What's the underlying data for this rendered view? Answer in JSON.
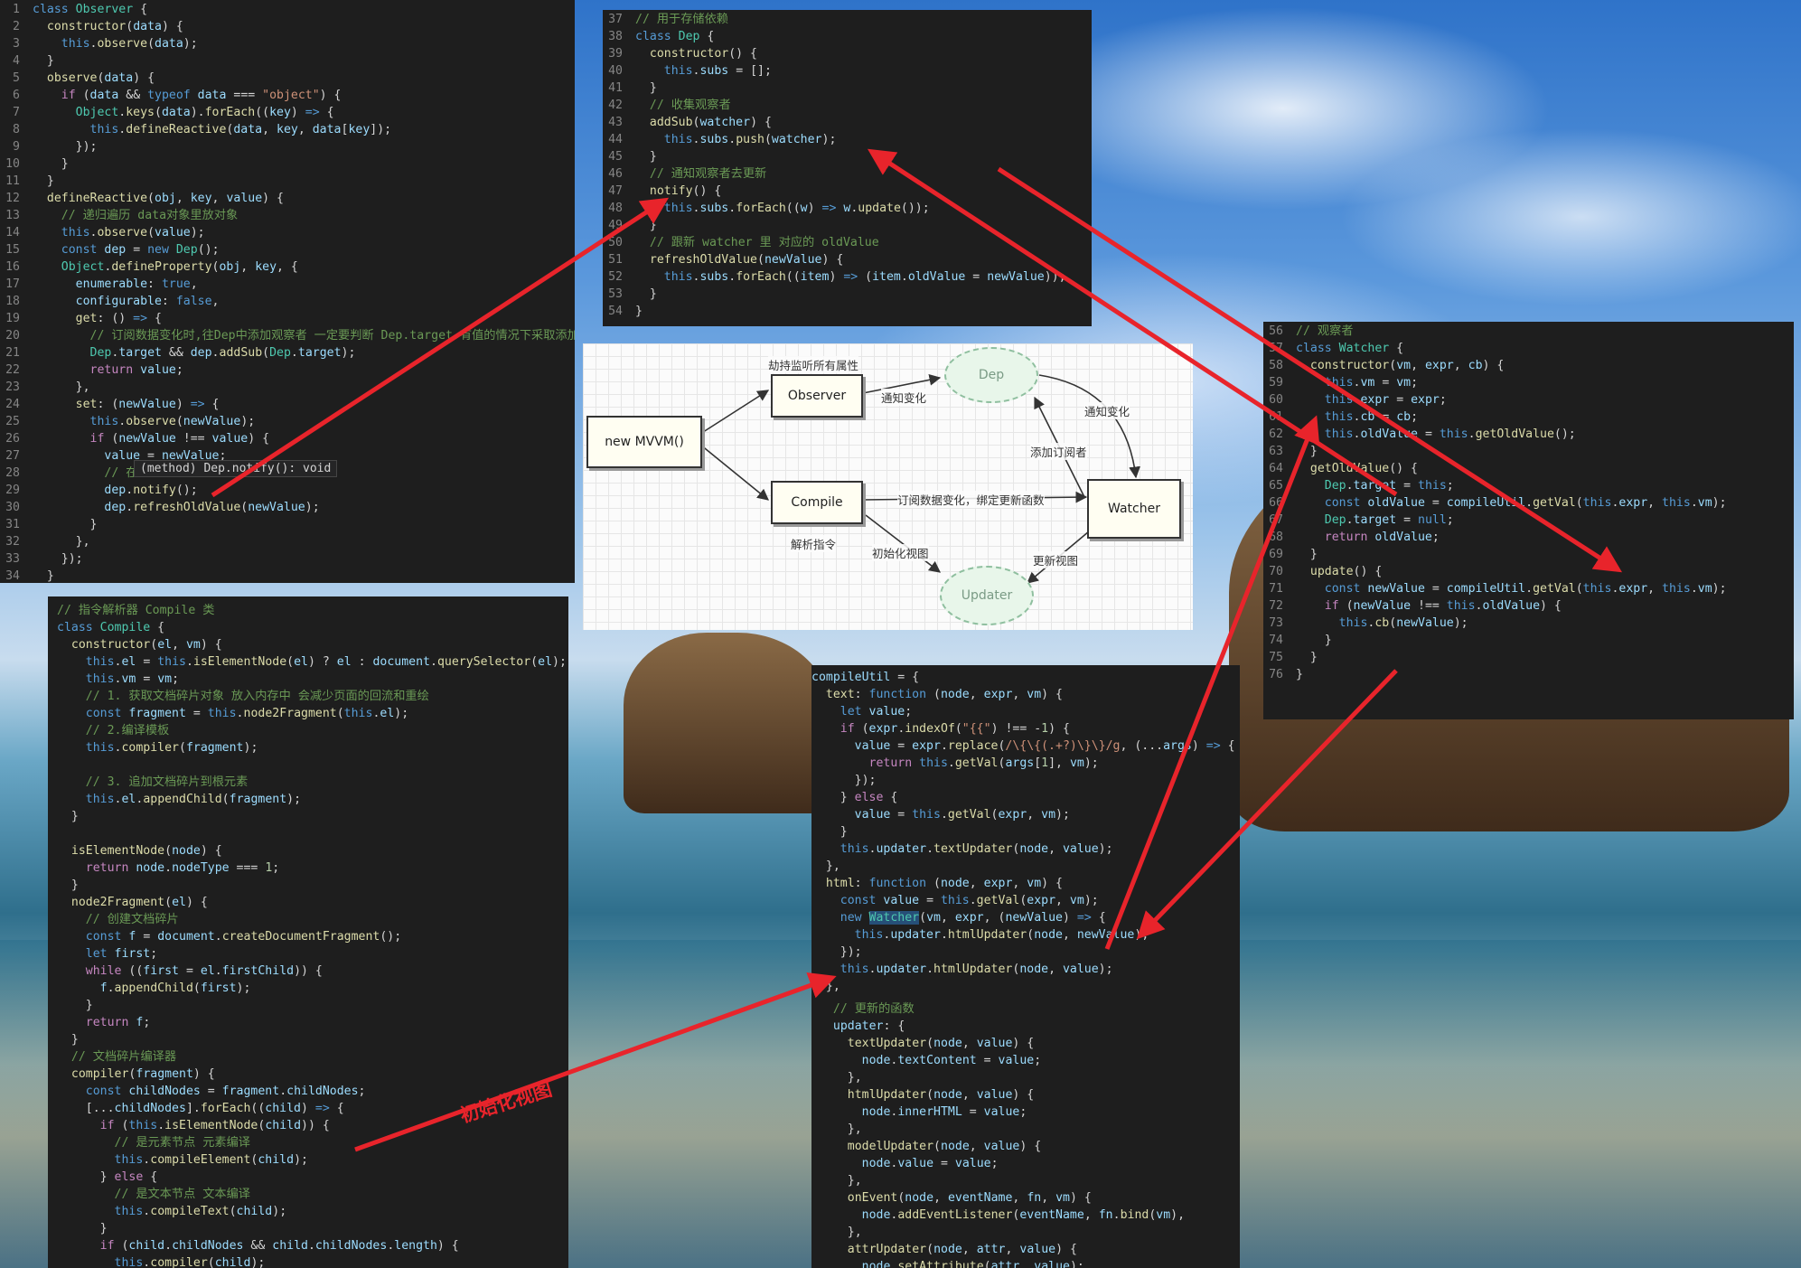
{
  "panel_observer": {
    "lines": [
      {
        "n": "1",
        "h": "<span class='k'>class</span> <span class='t'>Observer</span> {"
      },
      {
        "n": "2",
        "h": "  <span class='f'>constructor</span>(<span class='v'>data</span>) {"
      },
      {
        "n": "3",
        "h": "    <span class='k'>this</span>.<span class='f'>observe</span>(<span class='v'>data</span>);"
      },
      {
        "n": "4",
        "h": "  }"
      },
      {
        "n": "5",
        "h": "  <span class='f'>observe</span>(<span class='v'>data</span>) {"
      },
      {
        "n": "6",
        "h": "    <span class='p'>if</span> (<span class='v'>data</span> &amp;&amp; <span class='k'>typeof</span> <span class='v'>data</span> === <span class='s'>\"object\"</span>) {"
      },
      {
        "n": "7",
        "h": "      <span class='t'>Object</span>.<span class='f'>keys</span>(<span class='v'>data</span>).<span class='f'>forEach</span>((<span class='v'>key</span>) <span class='k'>=&gt;</span> {"
      },
      {
        "n": "8",
        "h": "        <span class='k'>this</span>.<span class='f'>defineReactive</span>(<span class='v'>data</span>, <span class='v'>key</span>, <span class='v'>data</span>[<span class='v'>key</span>]);"
      },
      {
        "n": "9",
        "h": "      });"
      },
      {
        "n": "10",
        "h": "    }"
      },
      {
        "n": "11",
        "h": "  }"
      },
      {
        "n": "12",
        "h": "  <span class='f'>defineReactive</span>(<span class='v'>obj</span>, <span class='v'>key</span>, <span class='v'>value</span>) {"
      },
      {
        "n": "13",
        "h": "    <span class='c'>// 递归遍历 data对象里放对象</span>"
      },
      {
        "n": "14",
        "h": "    <span class='k'>this</span>.<span class='f'>observe</span>(<span class='v'>value</span>);"
      },
      {
        "n": "15",
        "h": "    <span class='k'>const</span> <span class='v'>dep</span> = <span class='k'>new</span> <span class='t'>Dep</span>();"
      },
      {
        "n": "16",
        "h": "    <span class='t'>Object</span>.<span class='f'>defineProperty</span>(<span class='v'>obj</span>, <span class='v'>key</span>, {"
      },
      {
        "n": "17",
        "h": "      <span class='v'>enumerable</span>: <span class='k'>true</span>,"
      },
      {
        "n": "18",
        "h": "      <span class='v'>configurable</span>: <span class='k'>false</span>,"
      },
      {
        "n": "19",
        "h": "      <span class='f'>get</span>: () <span class='k'>=&gt;</span> {"
      },
      {
        "n": "20",
        "h": "        <span class='c'>// 订阅数据变化时,往Dep中添加观察者 一定要判断 Dep.target 有值的情况下采取添加</span>"
      },
      {
        "n": "21",
        "h": "        <span class='t'>Dep</span>.<span class='v'>target</span> &amp;&amp; <span class='v'>dep</span>.<span class='f'>addSub</span>(<span class='t'>Dep</span>.<span class='v'>target</span>);"
      },
      {
        "n": "22",
        "h": "        <span class='p'>return</span> <span class='v'>value</span>;"
      },
      {
        "n": "23",
        "h": "      },"
      },
      {
        "n": "24",
        "h": "      <span class='f'>set</span>: (<span class='v'>newValue</span>) <span class='k'>=&gt;</span> {"
      },
      {
        "n": "25",
        "h": "        <span class='k'>this</span>.<span class='f'>observe</span>(<span class='v'>newValue</span>);"
      },
      {
        "n": "26",
        "h": "        <span class='p'>if</span> (<span class='v'>newValue</span> !== <span class='v'>value</span>) {"
      },
      {
        "n": "27",
        "h": "          <span class='v'>value</span> = <span class='v'>newValue</span>;"
      },
      {
        "n": "28",
        "h": "          <span class='c'>// 在</span>"
      },
      {
        "n": "29",
        "h": "          <span class='v'>dep</span>.<span class='f'>notify</span>();"
      },
      {
        "n": "30",
        "h": "          <span class='v'>dep</span>.<span class='f'>refreshOldValue</span>(<span class='v'>newValue</span>);"
      },
      {
        "n": "31",
        "h": "        }"
      },
      {
        "n": "32",
        "h": "      },"
      },
      {
        "n": "33",
        "h": "    });"
      },
      {
        "n": "34",
        "h": "  }"
      }
    ],
    "tooltip": "(method) Dep.notify(): void"
  },
  "panel_dep": {
    "lines": [
      {
        "n": "37",
        "h": "<span class='c'>// 用于存储依赖</span>"
      },
      {
        "n": "38",
        "h": "<span class='k'>class</span> <span class='t'>Dep</span> {"
      },
      {
        "n": "39",
        "h": "  <span class='f'>constructor</span>() {"
      },
      {
        "n": "40",
        "h": "    <span class='k'>this</span>.<span class='v'>subs</span> = [];"
      },
      {
        "n": "41",
        "h": "  }"
      },
      {
        "n": "42",
        "h": "  <span class='c'>// 收集观察者</span>"
      },
      {
        "n": "43",
        "h": "  <span class='f'>addSub</span>(<span class='v'>watcher</span>) {"
      },
      {
        "n": "44",
        "h": "    <span class='k'>this</span>.<span class='v'>subs</span>.<span class='f'>push</span>(<span class='v'>watcher</span>);"
      },
      {
        "n": "45",
        "h": "  }"
      },
      {
        "n": "46",
        "h": "  <span class='c'>// 通知观察者去更新</span>"
      },
      {
        "n": "47",
        "h": "  <span class='f'>notify</span>() {"
      },
      {
        "n": "48",
        "h": "    <span class='k'>this</span>.<span class='v'>subs</span>.<span class='f'>forEach</span>((<span class='v'>w</span>) <span class='k'>=&gt;</span> <span class='v'>w</span>.<span class='f'>update</span>());"
      },
      {
        "n": "49",
        "h": "  }"
      },
      {
        "n": "50",
        "h": "  <span class='c'>// 跟新 watcher 里 对应的 oldValue</span>"
      },
      {
        "n": "51",
        "h": "  <span class='f'>refreshOldValue</span>(<span class='v'>newValue</span>) {"
      },
      {
        "n": "52",
        "h": "    <span class='k'>this</span>.<span class='v'>subs</span>.<span class='f'>forEach</span>((<span class='v'>item</span>) <span class='k'>=&gt;</span> (<span class='v'>item</span>.<span class='v'>oldValue</span> = <span class='v'>newValue</span>));"
      },
      {
        "n": "53",
        "h": "  }"
      },
      {
        "n": "54",
        "h": "}"
      }
    ]
  },
  "panel_watcher": {
    "lines": [
      {
        "n": "56",
        "h": "<span class='c'>// 观察者</span>"
      },
      {
        "n": "57",
        "h": "<span class='k'>class</span> <span class='t'>Watcher</span> {"
      },
      {
        "n": "58",
        "h": "  <span class='f'>constructor</span>(<span class='v'>vm</span>, <span class='v'>expr</span>, <span class='v'>cb</span>) {"
      },
      {
        "n": "59",
        "h": "    <span class='k'>this</span>.<span class='v'>vm</span> = <span class='v'>vm</span>;"
      },
      {
        "n": "60",
        "h": "    <span class='k'>this</span>.<span class='v'>expr</span> = <span class='v'>expr</span>;"
      },
      {
        "n": "61",
        "h": "    <span class='k'>this</span>.<span class='v'>cb</span> = <span class='v'>cb</span>;"
      },
      {
        "n": "62",
        "h": "    <span class='k'>this</span>.<span class='v'>oldValue</span> = <span class='k'>this</span>.<span class='f'>getOldValue</span>();"
      },
      {
        "n": "63",
        "h": "  }"
      },
      {
        "n": "64",
        "h": "  <span class='f'>getOldValue</span>() {"
      },
      {
        "n": "65",
        "h": "    <span class='t'>Dep</span>.<span class='v'>target</span> = <span class='k'>this</span>;"
      },
      {
        "n": "66",
        "h": "    <span class='k'>const</span> <span class='v'>oldValue</span> = <span class='v'>compileUtil</span>.<span class='f'>getVal</span>(<span class='k'>this</span>.<span class='v'>expr</span>, <span class='k'>this</span>.<span class='v'>vm</span>);"
      },
      {
        "n": "67",
        "h": "    <span class='t'>Dep</span>.<span class='v'>target</span> = <span class='k'>null</span>;"
      },
      {
        "n": "68",
        "h": "    <span class='p'>return</span> <span class='v'>oldValue</span>;"
      },
      {
        "n": "69",
        "h": "  }"
      },
      {
        "n": "70",
        "h": "  <span class='f'>update</span>() {"
      },
      {
        "n": "71",
        "h": "    <span class='k'>const</span> <span class='v'>newValue</span> = <span class='v'>compileUtil</span>.<span class='f'>getVal</span>(<span class='k'>this</span>.<span class='v'>expr</span>, <span class='k'>this</span>.<span class='v'>vm</span>);"
      },
      {
        "n": "72",
        "h": "    <span class='p'>if</span> (<span class='v'>newValue</span> !== <span class='k'>this</span>.<span class='v'>oldValue</span>) {"
      },
      {
        "n": "73",
        "h": "      <span class='k'>this</span>.<span class='f'>cb</span>(<span class='v'>newValue</span>);"
      },
      {
        "n": "74",
        "h": "    }"
      },
      {
        "n": "75",
        "h": "  }"
      },
      {
        "n": "76",
        "h": "}"
      }
    ]
  },
  "panel_compile": {
    "lines": [
      {
        "n": "",
        "h": "<span class='c'>// 指令解析器 Compile 类</span>"
      },
      {
        "n": "",
        "h": "<span class='k'>class</span> <span class='t'>Compile</span> {"
      },
      {
        "n": "",
        "h": "  <span class='f'>constructor</span>(<span class='v'>el</span>, <span class='v'>vm</span>) {"
      },
      {
        "n": "",
        "h": "    <span class='k'>this</span>.<span class='v'>el</span> = <span class='k'>this</span>.<span class='f'>isElementNode</span>(<span class='v'>el</span>) ? <span class='v'>el</span> : <span class='v'>document</span>.<span class='f'>querySelector</span>(<span class='v'>el</span>);"
      },
      {
        "n": "",
        "h": "    <span class='k'>this</span>.<span class='v'>vm</span> = <span class='v'>vm</span>;"
      },
      {
        "n": "",
        "h": "    <span class='c'>// 1. 获取文档碎片对象 放入内存中 会减少页面的回流和重绘</span>"
      },
      {
        "n": "",
        "h": "    <span class='k'>const</span> <span class='v'>fragment</span> = <span class='k'>this</span>.<span class='f'>node2Fragment</span>(<span class='k'>this</span>.<span class='v'>el</span>);"
      },
      {
        "n": "",
        "h": "    <span class='c'>// 2.编译模板</span>"
      },
      {
        "n": "",
        "h": "    <span class='k'>this</span>.<span class='f'>compiler</span>(<span class='v'>fragment</span>);"
      },
      {
        "n": "",
        "h": ""
      },
      {
        "n": "",
        "h": "    <span class='c'>// 3. 追加文档碎片到根元素</span>"
      },
      {
        "n": "",
        "h": "    <span class='k'>this</span>.<span class='v'>el</span>.<span class='f'>appendChild</span>(<span class='v'>fragment</span>);"
      },
      {
        "n": "",
        "h": "  }"
      },
      {
        "n": "",
        "h": ""
      },
      {
        "n": "",
        "h": "  <span class='f'>isElementNode</span>(<span class='v'>node</span>) {"
      },
      {
        "n": "",
        "h": "    <span class='p'>return</span> <span class='v'>node</span>.<span class='v'>nodeType</span> === <span class='n'>1</span>;"
      },
      {
        "n": "",
        "h": "  }"
      },
      {
        "n": "",
        "h": "  <span class='f'>node2Fragment</span>(<span class='v'>el</span>) {"
      },
      {
        "n": "",
        "h": "    <span class='c'>// 创建文档碎片</span>"
      },
      {
        "n": "",
        "h": "    <span class='k'>const</span> <span class='v'>f</span> = <span class='v'>document</span>.<span class='f'>createDocumentFragment</span>();"
      },
      {
        "n": "",
        "h": "    <span class='k'>let</span> <span class='v'>first</span>;"
      },
      {
        "n": "",
        "h": "    <span class='p'>while</span> ((<span class='v'>first</span> = <span class='v'>el</span>.<span class='v'>firstChild</span>)) {"
      },
      {
        "n": "",
        "h": "      <span class='v'>f</span>.<span class='f'>appendChild</span>(<span class='v'>first</span>);"
      },
      {
        "n": "",
        "h": "    }"
      },
      {
        "n": "",
        "h": "    <span class='p'>return</span> <span class='v'>f</span>;"
      },
      {
        "n": "",
        "h": "  }"
      },
      {
        "n": "",
        "h": "  <span class='c'>// 文档碎片编译器</span>"
      },
      {
        "n": "",
        "h": "  <span class='f'>compiler</span>(<span class='v'>fragment</span>) {"
      },
      {
        "n": "",
        "h": "    <span class='k'>const</span> <span class='v'>childNodes</span> = <span class='v'>fragment</span>.<span class='v'>childNodes</span>;"
      },
      {
        "n": "",
        "h": "    [...<span class='v'>childNodes</span>].<span class='f'>forEach</span>((<span class='v'>child</span>) <span class='k'>=&gt;</span> {"
      },
      {
        "n": "",
        "h": "      <span class='p'>if</span> (<span class='k'>this</span>.<span class='f'>isElementNode</span>(<span class='v'>child</span>)) {"
      },
      {
        "n": "",
        "h": "        <span class='c'>// 是元素节点 元素编译</span>"
      },
      {
        "n": "",
        "h": "        <span class='k'>this</span>.<span class='f'>compileElement</span>(<span class='v'>child</span>);"
      },
      {
        "n": "",
        "h": "      } <span class='p'>else</span> {"
      },
      {
        "n": "",
        "h": "        <span class='c'>// 是文本节点 文本编译</span>"
      },
      {
        "n": "",
        "h": "        <span class='k'>this</span>.<span class='f'>compileText</span>(<span class='v'>child</span>);"
      },
      {
        "n": "",
        "h": "      }"
      },
      {
        "n": "",
        "h": "      <span class='p'>if</span> (<span class='v'>child</span>.<span class='v'>childNodes</span> &amp;&amp; <span class='v'>child</span>.<span class='v'>childNodes</span>.<span class='v'>length</span>) {"
      },
      {
        "n": "",
        "h": "        <span class='k'>this</span>.<span class='f'>compiler</span>(<span class='v'>child</span>);"
      }
    ]
  },
  "panel_compileutil": {
    "lines": [
      {
        "n": "",
        "h": "<span class='v'>compileUtil</span> = {"
      },
      {
        "n": "",
        "h": "  <span class='f'>text</span>: <span class='k'>function</span> (<span class='v'>node</span>, <span class='v'>expr</span>, <span class='v'>vm</span>) {"
      },
      {
        "n": "",
        "h": "    <span class='k'>let</span> <span class='v'>value</span>;"
      },
      {
        "n": "",
        "h": "    <span class='p'>if</span> (<span class='v'>expr</span>.<span class='f'>indexOf</span>(<span class='s'>\"{{\"</span>) !== -<span class='n'>1</span>) {"
      },
      {
        "n": "",
        "h": "      <span class='v'>value</span> = <span class='v'>expr</span>.<span class='f'>replace</span>(<span class='s'>/\\{\\{(.+?)\\}\\}/g</span>, (...<span class='v'>args</span>) <span class='k'>=&gt;</span> {"
      },
      {
        "n": "",
        "h": "        <span class='p'>return</span> <span class='k'>this</span>.<span class='f'>getVal</span>(<span class='v'>args</span>[<span class='n'>1</span>], <span class='v'>vm</span>);"
      },
      {
        "n": "",
        "h": "      });"
      },
      {
        "n": "",
        "h": "    } <span class='p'>else</span> {"
      },
      {
        "n": "",
        "h": "      <span class='v'>value</span> = <span class='k'>this</span>.<span class='f'>getVal</span>(<span class='v'>expr</span>, <span class='v'>vm</span>);"
      },
      {
        "n": "",
        "h": "    }"
      },
      {
        "n": "",
        "h": "    <span class='k'>this</span>.<span class='v'>updater</span>.<span class='f'>textUpdater</span>(<span class='v'>node</span>, <span class='v'>value</span>);"
      },
      {
        "n": "",
        "h": "  },"
      },
      {
        "n": "",
        "h": "  <span class='f'>html</span>: <span class='k'>function</span> (<span class='v'>node</span>, <span class='v'>expr</span>, <span class='v'>vm</span>) {"
      },
      {
        "n": "",
        "h": "    <span class='k'>const</span> <span class='v'>value</span> = <span class='k'>this</span>.<span class='f'>getVal</span>(<span class='v'>expr</span>, <span class='v'>vm</span>);"
      },
      {
        "n": "",
        "h": "    <span class='k'>new</span> <span class='t' style='background:#264f78'>Watcher</span>(<span class='v'>vm</span>, <span class='v'>expr</span>, (<span class='v'>newValue</span>) <span class='k'>=&gt;</span> {"
      },
      {
        "n": "",
        "h": "      <span class='k'>this</span>.<span class='v'>updater</span>.<span class='f'>htmlUpdater</span>(<span class='v'>node</span>, <span class='v'>newValue</span>);"
      },
      {
        "n": "",
        "h": "    });"
      },
      {
        "n": "",
        "h": "    <span class='k'>this</span>.<span class='v'>updater</span>.<span class='f'>htmlUpdater</span>(<span class='v'>node</span>, <span class='v'>value</span>);"
      },
      {
        "n": "",
        "h": "  },"
      }
    ]
  },
  "panel_updater": {
    "lines": [
      {
        "n": "",
        "h": "  <span class='c'>// 更新的函数</span>"
      },
      {
        "n": "",
        "h": "  <span class='v'>updater</span>: {"
      },
      {
        "n": "",
        "h": "    <span class='f'>textUpdater</span>(<span class='v'>node</span>, <span class='v'>value</span>) {"
      },
      {
        "n": "",
        "h": "      <span class='v'>node</span>.<span class='v'>textContent</span> = <span class='v'>value</span>;"
      },
      {
        "n": "",
        "h": "    },"
      },
      {
        "n": "",
        "h": "    <span class='f'>htmlUpdater</span>(<span class='v'>node</span>, <span class='v'>value</span>) {"
      },
      {
        "n": "",
        "h": "      <span class='v'>node</span>.<span class='v'>innerHTML</span> = <span class='v'>value</span>;"
      },
      {
        "n": "",
        "h": "    },"
      },
      {
        "n": "",
        "h": "    <span class='f'>modelUpdater</span>(<span class='v'>node</span>, <span class='v'>value</span>) {"
      },
      {
        "n": "",
        "h": "      <span class='v'>node</span>.<span class='v'>value</span> = <span class='v'>value</span>;"
      },
      {
        "n": "",
        "h": "    },"
      },
      {
        "n": "",
        "h": "    <span class='f'>onEvent</span>(<span class='v'>node</span>, <span class='v'>eventName</span>, <span class='v'>fn</span>, <span class='v'>vm</span>) {"
      },
      {
        "n": "",
        "h": "      <span class='v'>node</span>.<span class='f'>addEventListener</span>(<span class='v'>eventName</span>, <span class='v'>fn</span>.<span class='f'>bind</span>(<span class='v'>vm</span>),"
      },
      {
        "n": "",
        "h": "    },"
      },
      {
        "n": "",
        "h": "    <span class='f'>attrUpdater</span>(<span class='v'>node</span>, <span class='v'>attr</span>, <span class='v'>value</span>) {"
      },
      {
        "n": "",
        "h": "      <span class='v'>node</span>.<span class='f'>setAttribute</span>(<span class='v'>attr</span>, <span class='v'>value</span>);"
      }
    ]
  },
  "diagram": {
    "new_mvvm": "new MVVM()",
    "observer": "Observer",
    "compile": "Compile",
    "dep": "Dep",
    "watcher": "Watcher",
    "updater": "Updater",
    "label_hijack": "劫持监听所有属性",
    "label_notify_change_1": "通知变化",
    "label_notify_change_2": "通知变化",
    "label_add_subscriber": "添加订阅者",
    "label_subscribe": "订阅数据变化，绑定更新函数",
    "label_parse": "解析指令",
    "label_init_view": "初始化视图",
    "label_update_view": "更新视图"
  },
  "annotation": {
    "label": "初始化视图",
    "color": "#e8242b"
  }
}
